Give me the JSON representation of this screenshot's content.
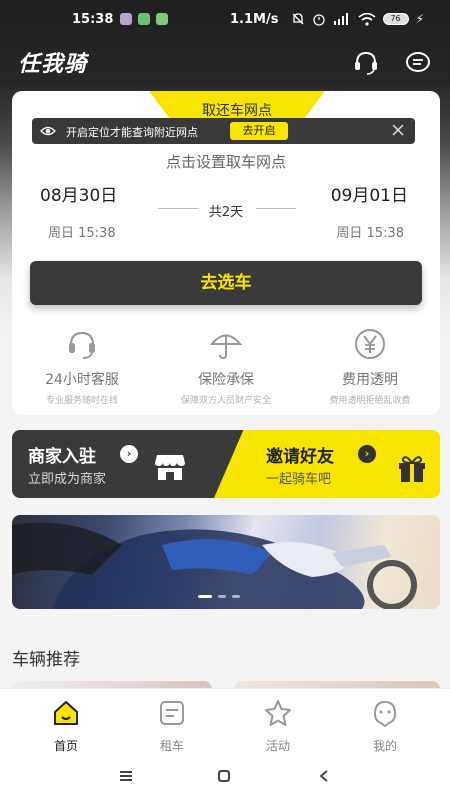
{
  "status_bar": {
    "time": "15:38",
    "network_speed": "1.1M/s",
    "battery": "76"
  },
  "header": {
    "app_title": "任我骑",
    "icons": [
      "headset-icon",
      "message-icon"
    ]
  },
  "booking": {
    "tab_label": "取还车网点",
    "notice": {
      "text": "开启定位才能查询附近网点",
      "button": "去开启"
    },
    "set_point_hint": "点击设置取车网点",
    "pickup_date": "08月30日",
    "return_date": "09月01日",
    "duration": "共2天",
    "pickup_time": "周日 15:38",
    "return_time": "周日 15:38",
    "select_button": "去选车"
  },
  "features": [
    {
      "title": "24小时客服",
      "subtitle": "专业服务随时在线",
      "icon": "headset-icon"
    },
    {
      "title": "保险承保",
      "subtitle": "保障双方人员财产安全",
      "icon": "umbrella-icon"
    },
    {
      "title": "费用透明",
      "subtitle": "费用透明拒绝乱收费",
      "icon": "yuan-icon"
    }
  ],
  "promos": {
    "merchant": {
      "title": "商家入驻",
      "subtitle": "立即成为商家"
    },
    "invite": {
      "title": "邀请好友",
      "subtitle": "一起骑车吧"
    }
  },
  "banner": {
    "slide_count": 3,
    "active_slide": 1
  },
  "section": {
    "title": "车辆推荐"
  },
  "tabbar": {
    "items": [
      {
        "label": "首页",
        "icon": "home-icon",
        "active": true
      },
      {
        "label": "租车",
        "icon": "list-icon",
        "active": false
      },
      {
        "label": "活动",
        "icon": "star-icon",
        "active": false
      },
      {
        "label": "我的",
        "icon": "face-icon",
        "active": false
      }
    ]
  },
  "colors": {
    "accent": "#f7e400",
    "dark": "#3a3a3a"
  }
}
